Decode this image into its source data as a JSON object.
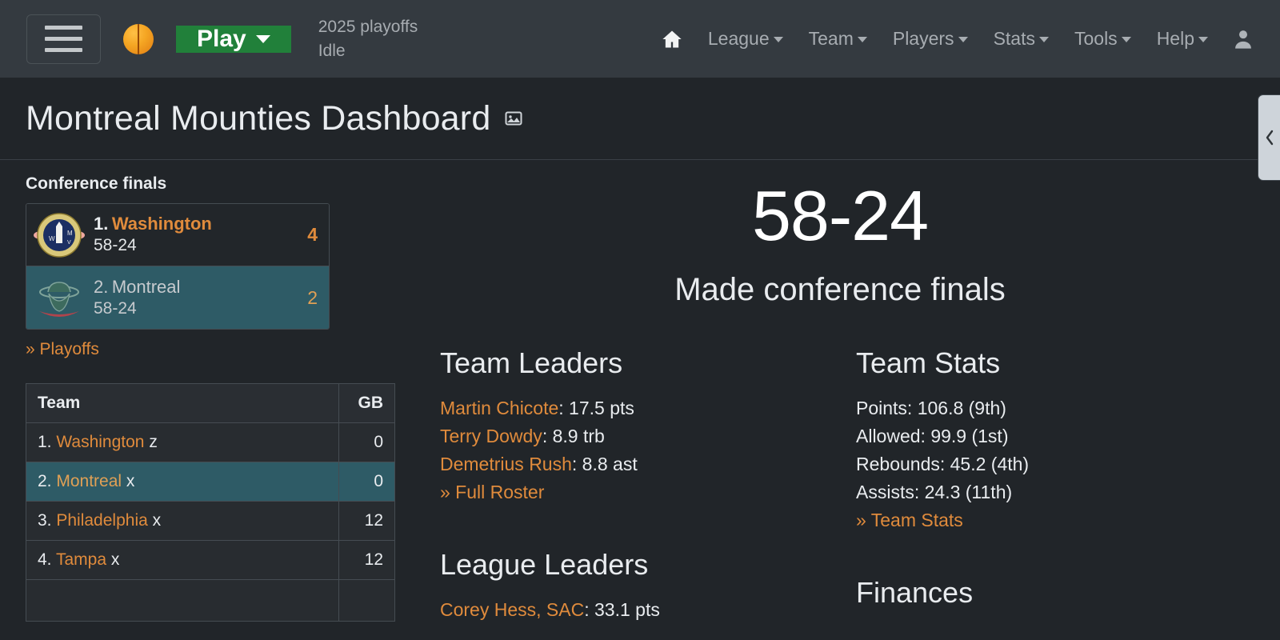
{
  "navbar": {
    "menu_icon": "hamburger-icon",
    "brand_icon": "basketball-icon",
    "play_label": "Play",
    "season_label": "2025 playoffs",
    "status_label": "Idle",
    "home_icon": "home-icon",
    "user_icon": "user-account-icon",
    "items": [
      {
        "label": "League"
      },
      {
        "label": "Team"
      },
      {
        "label": "Players"
      },
      {
        "label": "Stats"
      },
      {
        "label": "Tools"
      },
      {
        "label": "Help"
      }
    ]
  },
  "header": {
    "title": "Montreal Mounties Dashboard",
    "title_icon": "open-in-new-window-icon",
    "collapse_icon": "chevron-left-icon"
  },
  "sidebar": {
    "series_label": "Conference finals",
    "series": [
      {
        "seed": "1.",
        "team": "Washington",
        "record": "58-24",
        "wins": "4",
        "logo": "washington-monument-crest-logo"
      },
      {
        "seed": "2.",
        "team": "Montreal",
        "record": "58-24",
        "wins": "2",
        "logo": "mountie-hat-logo"
      }
    ],
    "playoffs_link": "» Playoffs",
    "standings": {
      "columns": [
        "Team",
        "GB"
      ],
      "rows": [
        {
          "rank": "1.",
          "team": "Washington",
          "tag": "z",
          "gb": "0",
          "selected": false
        },
        {
          "rank": "2.",
          "team": "Montreal",
          "tag": "x",
          "gb": "0",
          "selected": true
        },
        {
          "rank": "3.",
          "team": "Philadelphia",
          "tag": "x",
          "gb": "12",
          "selected": false
        },
        {
          "rank": "4.",
          "team": "Tampa",
          "tag": "x",
          "gb": "12",
          "selected": false
        }
      ]
    }
  },
  "main": {
    "record": "58-24",
    "record_subtitle": "Made conference finals",
    "team_leaders": {
      "heading": "Team Leaders",
      "lines": [
        {
          "name": "Martin Chicote",
          "value": ": 17.5 pts"
        },
        {
          "name": "Terry Dowdy",
          "value": ": 8.9 trb"
        },
        {
          "name": "Demetrius Rush",
          "value": ": 8.8 ast"
        }
      ],
      "link": "» Full Roster"
    },
    "league_leaders": {
      "heading": "League Leaders",
      "lines": [
        {
          "name": "Corey Hess",
          "team": ", SAC",
          "value": ": 33.1 pts"
        }
      ]
    },
    "team_stats": {
      "heading": "Team Stats",
      "lines": [
        "Points: 106.8 (9th)",
        "Allowed: 99.9 (1st)",
        "Rebounds: 45.2 (4th)",
        "Assists: 24.3 (11th)"
      ],
      "link": "» Team Stats"
    },
    "finances": {
      "heading": "Finances"
    }
  },
  "colors": {
    "page_bg": "#212529",
    "navbar_bg": "#343a40",
    "accent_orange": "#e08b3c",
    "play_green": "#21803a",
    "selected_teal": "#2e5b66",
    "text_light": "#e9ecef"
  }
}
